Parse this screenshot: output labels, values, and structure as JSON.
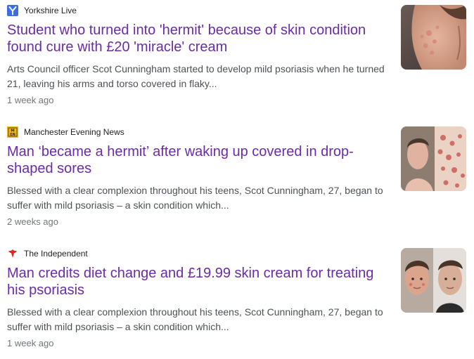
{
  "results": [
    {
      "source": "Yorkshire Live",
      "source_icon": "yorkshire-live-logo-icon",
      "headline": "Student who turned into 'hermit' because of skin condition found cure with £20 'miracle' cream",
      "snippet": "Arts Council officer Scot Cunningham started to develop mild psoriasis when he turned 21, leaving his arms and torso covered in flaky...",
      "time": "1 week ago"
    },
    {
      "source": "Manchester Evening News",
      "source_icon": "manchester-evening-news-logo-icon",
      "headline": "Man ‘became a hermit’ after waking up covered in drop-shaped sores",
      "snippet": "Blessed with a clear complexion throughout his teens, Scot Cunningham, 27, began to suffer with mild psoriasis – a skin condition which...",
      "time": "2 weeks ago"
    },
    {
      "source": "The Independent",
      "source_icon": "the-independent-eagle-icon",
      "headline": "Man credits diet change and £19.99 skin cream for treating his psoriasis",
      "snippet": "Blessed with a clear complexion throughout his teens, Scot Cunningham, 27, began to suffer with mild psoriasis – a skin condition which...",
      "time": "1 week ago"
    }
  ],
  "colors": {
    "headline": "#6b2ba7",
    "snippet": "#4d5156",
    "time": "#70757a",
    "yorkshire_live_brand": "#3b6fe0",
    "men_brand": "#f2b81b",
    "independent_brand": "#e1261c"
  }
}
